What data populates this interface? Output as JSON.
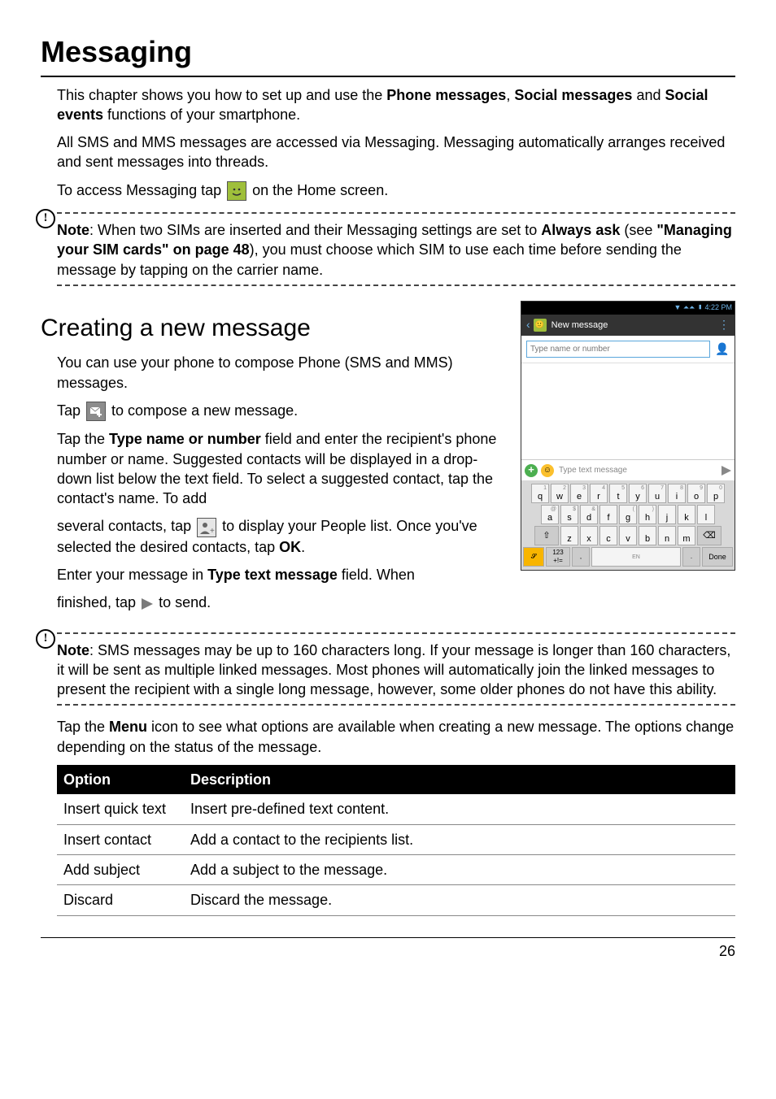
{
  "page": {
    "title": "Messaging",
    "number": "26"
  },
  "intro": {
    "p1_a": "This chapter shows you how to set up and use the ",
    "p1_b": "Phone messages",
    "p1_c": ", ",
    "p1_d": "Social messages",
    "p1_e": " and ",
    "p1_f": "Social events",
    "p1_g": " functions of your smartphone.",
    "p2": "All SMS and MMS messages are accessed via Messaging. Messaging automatically arranges received and sent messages into threads.",
    "p3_a": "To access Messaging tap ",
    "p3_b": " on the Home screen."
  },
  "note1": {
    "label": "Note",
    "a": ": When two SIMs are inserted and their Messaging settings are set to ",
    "b": "Always ask",
    "c": " (see ",
    "d": "\"Managing your SIM cards\" on page 48",
    "e": "), you must choose which SIM to use each time before sending the message by tapping on the carrier name."
  },
  "section": {
    "title": "Creating a new message",
    "p1": "You can use your phone to compose Phone (SMS and MMS) messages.",
    "p2_a": "Tap ",
    "p2_b": " to compose a new message.",
    "p3_a": "Tap the ",
    "p3_b": "Type name or number",
    "p3_c": " field and enter the recipient's phone number or name. Suggested contacts will be displayed in a drop-down list below the text field. To select a suggested contact, tap the contact's name. To add",
    "p4_a": "several contacts, tap ",
    "p4_b": " to display your People list. Once you've selected the desired contacts, tap ",
    "p4_c": "OK",
    "p4_d": ".",
    "p5_a": "Enter your message in ",
    "p5_b": "Type text message",
    "p5_c": " field. When",
    "p6_a": "finished, tap ",
    "p6_b": " to send."
  },
  "note2": {
    "label": "Note",
    "text": ": SMS messages may be up to 160 characters long. If your message is longer than 160 characters, it will be sent as multiple linked messages. Most phones will automatically join the linked messages to present the recipient with a single long message, however, some older phones do not have this ability."
  },
  "menu_para_a": "Tap the ",
  "menu_para_b": "Menu",
  "menu_para_c": " icon to see what options are available when creating a new message. The options change depending on the status of the message.",
  "table": {
    "h1": "Option",
    "h2": "Description",
    "rows": [
      {
        "opt": "Insert quick text",
        "desc": "Insert pre-defined text content."
      },
      {
        "opt": "Insert contact",
        "desc": "Add a contact to the recipients list."
      },
      {
        "opt": "Add subject",
        "desc": "Add a subject to the message."
      },
      {
        "opt": "Discard",
        "desc": "Discard the message."
      }
    ]
  },
  "phone": {
    "time": "4:22 PM",
    "header_title": "New message",
    "recipient_placeholder": "Type name or number",
    "compose_placeholder": "Type text message",
    "keys_row1": [
      "q",
      "w",
      "e",
      "r",
      "t",
      "y",
      "u",
      "i",
      "o",
      "p"
    ],
    "nums_row1": [
      "1",
      "2",
      "3",
      "4",
      "5",
      "6",
      "7",
      "8",
      "9",
      "0"
    ],
    "keys_row2": [
      "a",
      "s",
      "d",
      "f",
      "g",
      "h",
      "j",
      "k",
      "l"
    ],
    "nums_row2": [
      "@",
      "$",
      "&",
      "",
      "(",
      ")",
      "",
      "",
      ""
    ],
    "keys_row3": [
      "z",
      "x",
      "c",
      "v",
      "b",
      "n",
      "m"
    ],
    "num_key_top": "123",
    "num_key_bot": "+!=",
    "space_label": "EN",
    "done": "Done"
  }
}
